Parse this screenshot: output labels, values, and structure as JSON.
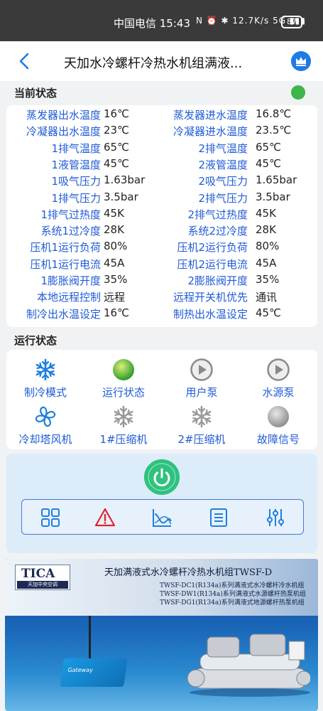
{
  "statusbar": {
    "carrier_time": "中国电信 15:43",
    "icons": "N ⏰ ✱ 12.7K/s 5G ▮▮▮",
    "battery": "87"
  },
  "header": {
    "title": "天加水冷螺杆冷热水机组满液..."
  },
  "current_status": {
    "section_title": "当前状态",
    "indicator_color": "#3fb54a",
    "rows": [
      {
        "l1": "蒸发器出水温度",
        "v1": "16℃",
        "l2": "蒸发器进水温度",
        "v2": "16.8℃"
      },
      {
        "l1": "冷凝器出水温度",
        "v1": "23℃",
        "l2": "冷凝器进水温度",
        "v2": "23.5℃"
      },
      {
        "l1": "1排气温度",
        "v1": "65℃",
        "l2": "2排气温度",
        "v2": "65℃"
      },
      {
        "l1": "1液管温度",
        "v1": "45℃",
        "l2": "2液管温度",
        "v2": "45℃"
      },
      {
        "l1": "1吸气压力",
        "v1": "1.63bar",
        "l2": "2吸气压力",
        "v2": "1.65bar"
      },
      {
        "l1": "1排气压力",
        "v1": "3.5bar",
        "l2": "2排气压力",
        "v2": "3.5bar"
      },
      {
        "l1": "1排气过热度",
        "v1": "45K",
        "l2": "2排气过热度",
        "v2": "45K"
      },
      {
        "l1": "系统1过冷度",
        "v1": "28K",
        "l2": "系统2过冷度",
        "v2": "28K"
      },
      {
        "l1": "压机1运行负荷",
        "v1": "80%",
        "l2": "压机2运行负荷",
        "v2": "80%"
      },
      {
        "l1": "压机1运行电流",
        "v1": "45A",
        "l2": "压机2运行电流",
        "v2": "45A"
      },
      {
        "l1": "1膨胀阀开度",
        "v1": "35%",
        "l2": "2膨胀阀开度",
        "v2": "35%"
      },
      {
        "l1": "本地远程控制",
        "v1": "远程",
        "l2": "远程开关机优先",
        "v2": "通讯"
      },
      {
        "l1": "制冷出水温设定",
        "v1": "16℃",
        "l2": "制热出水温设定",
        "v2": "45℃"
      }
    ]
  },
  "run_status": {
    "section_title": "运行状态",
    "items": [
      {
        "label": "制冷模式",
        "icon": "snowflake-icon",
        "color": "#1f7fe0"
      },
      {
        "label": "运行状态",
        "icon": "green-light-icon",
        "color": "#43b02a"
      },
      {
        "label": "用户泵",
        "icon": "pump-play-icon",
        "color": "#8a8a8a"
      },
      {
        "label": "水源泵",
        "icon": "pump-play-icon",
        "color": "#8a8a8a"
      },
      {
        "label": "冷却塔风机",
        "icon": "fan-icon",
        "color": "#1f7fe0"
      },
      {
        "label": "1#压缩机",
        "icon": "snowflake-icon",
        "color": "#9a9a9a"
      },
      {
        "label": "2#压缩机",
        "icon": "snowflake-icon",
        "color": "#9a9a9a"
      },
      {
        "label": "故障信号",
        "icon": "gray-light-icon",
        "color": "#a6a6a6"
      }
    ]
  },
  "controls": {
    "power_color": "#2ec27e",
    "tools": [
      "grid-icon",
      "warning-icon",
      "chart-icon",
      "list-icon",
      "sliders-icon"
    ]
  },
  "banner": {
    "logo": "TICA",
    "logo_sub": "天加中央空调",
    "title": "天加满液式水冷螺杆冷热水机组TWSF-D",
    "lines": [
      "TWSF-DC1(R134a)系列满液式水冷螺杆冷水机组",
      "TWSF-DW1(R134a)系列满液式水源螺杆热泵机组",
      "TWSF-DG1(R134a)系列满液式地源螺杆热泵机组"
    ],
    "gateway_label": "Gateway"
  }
}
